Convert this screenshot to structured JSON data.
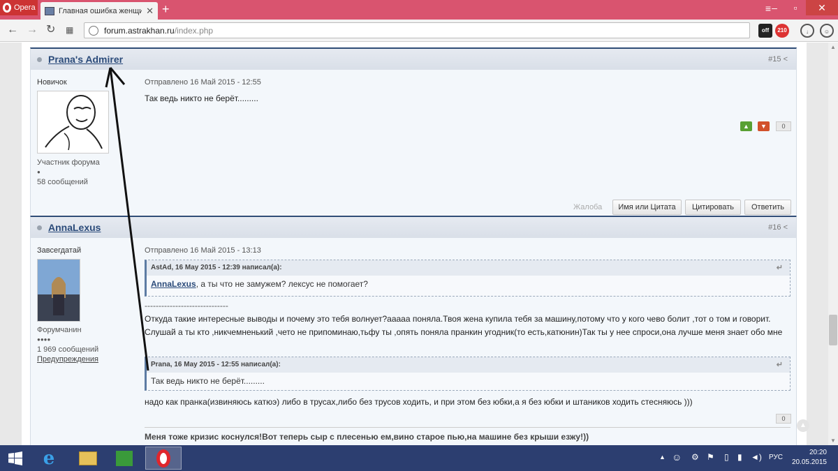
{
  "browser": {
    "menu_label": "Opera",
    "tab_title": "Главная ошибка женщин",
    "url_host": "forum.astrakhan.ru",
    "url_path": "/index.php",
    "ext_off_label": "off",
    "ext_count_label": "210"
  },
  "posts": [
    {
      "author": "Prana's Admirer",
      "number": "#15",
      "rank": "Новичок",
      "group": "Участник форума",
      "pips": "●",
      "messages": "58 сообщений",
      "date": "Отправлено 16 Май 2015 - 12:55",
      "text": "Так ведь никто не берёт.........",
      "vote_count": "0",
      "report_label": "Жалоба",
      "btn_name_quote": "Имя или Цитата",
      "btn_quote": "Цитировать",
      "btn_reply": "Ответить"
    },
    {
      "author": "AnnaLexus",
      "number": "#16",
      "rank": "Завсегдатай",
      "group": "Форумчанин",
      "pips": "●●●●",
      "messages": "1 969 сообщений",
      "warnings": "Предупреждения",
      "date": "Отправлено 16 Май 2015 - 13:13",
      "quote1_head": "AstAd, 16 May 2015 - 12:39 написал(а):",
      "quote1_link": "AnnaLexus",
      "quote1_text": ", а ты что не замужем? лексус не помогает?",
      "divider": "------------------------------",
      "paragraph": "Откуда такие интересные выводы и почему это тебя волнует?ааааа поняла.Твоя жена купила тебя за машину,потому что у кого чево болит ,тот о том и говорит. Слушай а ты кто ,никчемненький ,чето не припоминаю,тьфу ты ,опять поняла пранкин угодник(то есть,катюнин)Так ты у нее спроси,она лучше меня знает обо мне",
      "quote2_head": "Prana, 16 May 2015 - 12:55 написал(а):",
      "quote2_text": "Так ведь никто не берёт.........",
      "after_quote": "надо как пранка(извиняюсь катюэ) либо в трусах,либо без трусов ходить, и при этом без юбки,а я без юбки и штаников ходить стесняюсь )))",
      "vote_count": "0",
      "signature": "Меня тоже кризис коснулся!Вот теперь сыр с плесенью ем,вино старое пью,на машине без крыши езжу!))"
    }
  ],
  "taskbar": {
    "language": "РУС",
    "time": "20:20",
    "date": "20.05.2015"
  },
  "colors": {
    "tab_bar": "#d9546f",
    "post_border": "#2f4c76",
    "taskbar": "#2c3e70"
  }
}
